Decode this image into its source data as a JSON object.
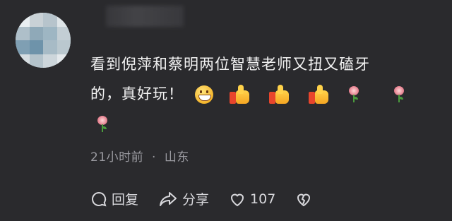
{
  "comment": {
    "text_line1": "看到倪萍和蔡明两位智慧老师又扭又磕牙",
    "text_line2": "的，真好玩！",
    "emojis": [
      "grin-icon",
      "thumbs-up-icon",
      "thumbs-up-icon",
      "thumbs-up-icon",
      "rose-icon",
      "rose-icon",
      "rose-icon"
    ]
  },
  "meta": {
    "time": "21小时前",
    "separator": "·",
    "location": "山东"
  },
  "actions": {
    "reply_label": "回复",
    "share_label": "分享",
    "like_count": "107"
  },
  "colors": {
    "background": "#2a2a2d",
    "text": "#f2f2f2",
    "meta_text": "#9a9aa0"
  }
}
